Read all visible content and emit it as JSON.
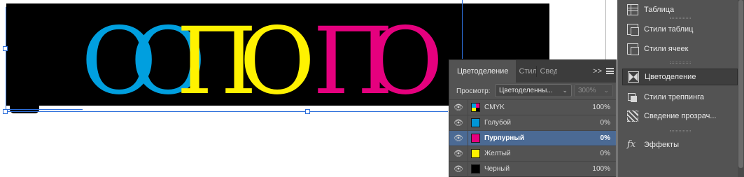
{
  "canvas": {
    "letters": [
      "О",
      "О",
      "П",
      "О",
      "П",
      "О"
    ],
    "colors": {
      "cyan": "#009fdf",
      "yellow": "#fff200",
      "magenta": "#e5007e",
      "frame": "#000000"
    }
  },
  "separations": {
    "tabs": [
      "Цветоделение",
      "Стил",
      "Свед"
    ],
    "more": ">>",
    "view_label": "Просмотр:",
    "view_value": "Цветоделенны...",
    "zoom_value": "300%",
    "inks": [
      {
        "name": "CMYK",
        "percent": "100%",
        "swatch": "cmyk"
      },
      {
        "name": "Голубой",
        "percent": "0%",
        "swatch": "#0096d6"
      },
      {
        "name": "Пурпурный",
        "percent": "0%",
        "swatch": "#e5007e",
        "selected": true
      },
      {
        "name": "Желтый",
        "percent": "0%",
        "swatch": "#fff200"
      },
      {
        "name": "Черный",
        "percent": "100%",
        "swatch": "#000000"
      }
    ]
  },
  "dock": {
    "items": [
      {
        "label": "Таблица",
        "icon": "table-icon"
      },
      {
        "label": "Стили таблиц",
        "icon": "table-styles-icon"
      },
      {
        "label": "Стили ячеек",
        "icon": "cell-styles-icon"
      },
      {
        "label": "Цветоделение",
        "icon": "separations-icon",
        "active": true
      },
      {
        "label": "Стили треппинга",
        "icon": "trap-styles-icon"
      },
      {
        "label": "Сведение прозрач...",
        "icon": "flattener-icon"
      },
      {
        "label": "Эффекты",
        "icon": "fx-icon"
      }
    ]
  }
}
